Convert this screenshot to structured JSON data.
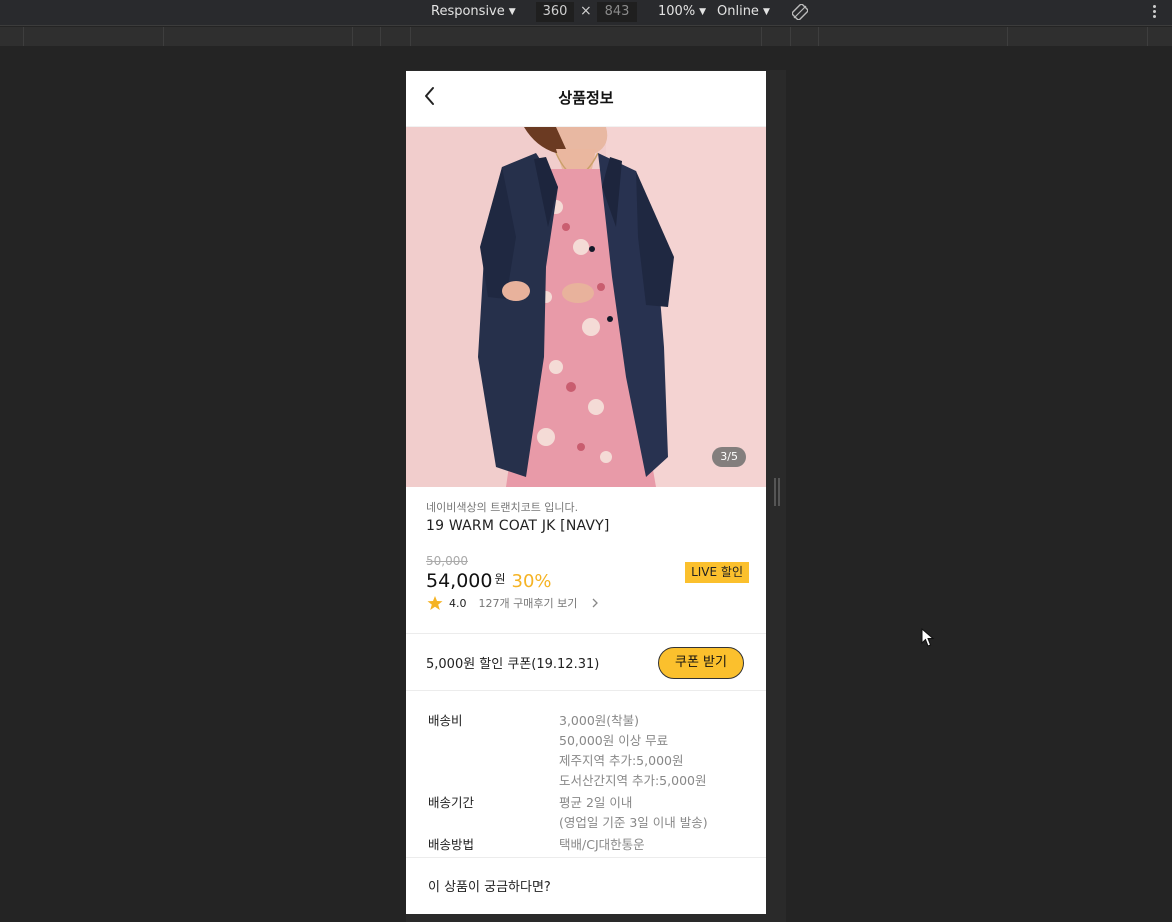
{
  "devtools": {
    "device_mode": "Responsive",
    "width": "360",
    "times": "×",
    "height": "843",
    "zoom": "100%",
    "network": "Online",
    "icons": [
      "rotate-icon",
      "kebab-menu-icon"
    ]
  },
  "app": {
    "title": "상품정보",
    "back_icon": "chevron-left-icon",
    "image_counter": "3/5",
    "product": {
      "subtitle": "네이비색상의 트랜치코트 입니다.",
      "name": "19 WARM COAT JK [NAVY]",
      "original_price": "50,000",
      "price": "54,000",
      "currency": "원",
      "discount": "30%",
      "live_badge": "LIVE 할인",
      "rating": "4.0",
      "reviews_link": "127개 구매후기 보기"
    },
    "coupon": {
      "text": "5,000원 할인 쿠폰(19.12.31)",
      "button": "쿠폰 받기"
    },
    "shipping": [
      {
        "label": "배송비",
        "values": [
          "3,000원(착불)",
          "50,000원 이상 무료",
          "제주지역 추가:5,000원",
          "도서산간지역 추가:5,000원"
        ]
      },
      {
        "label": "배송기간",
        "values": [
          "평균 2일 이내",
          "(영업일 기준 3일 이내 발송)"
        ]
      },
      {
        "label": "배송방법",
        "values": [
          "택배/CJ대한통운"
        ]
      }
    ],
    "question": "이 상품이 궁금하다면?"
  },
  "colors": {
    "accent": "#fbc02d",
    "discount": "#f5b324",
    "devtools_bg": "#242424"
  }
}
